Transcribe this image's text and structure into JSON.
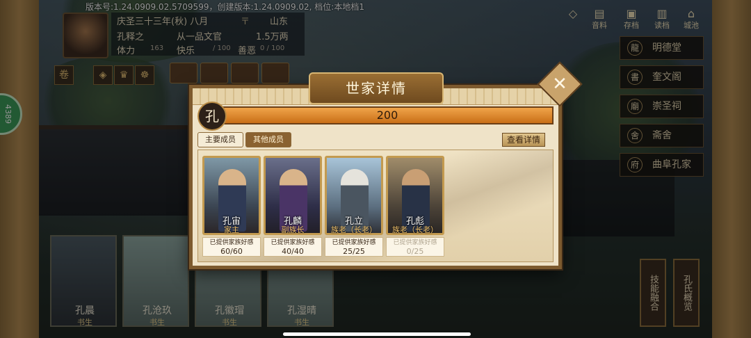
{
  "status": {
    "version_text": "版本号:1.24.0909.02.5709599，创建版本:1.24.0909.02, 档位:本地档1"
  },
  "player": {
    "date": "庆圣三十三年(秋) 八月",
    "location": "山东",
    "name": "孔释之",
    "rank": "从一品文官",
    "money": "1.5万两",
    "stamina_label": "体力",
    "stamina_value": "163",
    "happiness_label": "快乐",
    "happiness_value": "/ 100",
    "morality_label": "善恶",
    "morality_value": "0 / 100",
    "sidebar_coin": "4389"
  },
  "top_right_icons": [
    {
      "label": "音料",
      "icon": "book-icon"
    },
    {
      "label": "存档",
      "icon": "save-icon"
    },
    {
      "label": "读档",
      "icon": "load-icon"
    },
    {
      "label": "城池",
      "icon": "city-icon"
    }
  ],
  "side_menu": [
    {
      "label": "明德堂",
      "icon": "dragon-icon"
    },
    {
      "label": "奎文阁",
      "icon": "book-icon"
    },
    {
      "label": "崇圣祠",
      "icon": "temple-icon"
    },
    {
      "label": "斋舍",
      "icon": "house-icon"
    },
    {
      "label": "曲阜孔家",
      "icon": "mansion-icon"
    }
  ],
  "vertical_buttons": [
    {
      "label": "技能融合"
    },
    {
      "label": "孔氏概览"
    }
  ],
  "background_cards": [
    {
      "name": "孔晨",
      "rank": "书生"
    },
    {
      "name": "孔沧玖",
      "rank": "书生"
    },
    {
      "name": "孔徽瑁",
      "rank": "书生"
    },
    {
      "name": "孔湿晴",
      "rank": "书生"
    }
  ],
  "modal": {
    "title": "世家详情",
    "surname": "孔",
    "score": "200",
    "tabs": [
      "主要成员",
      "其他成员"
    ],
    "active_tab": "其他成员",
    "detail_button": "查看详情",
    "members": [
      {
        "name": "孔宙",
        "rank": "家主",
        "fav_label": "已提供家族好感",
        "fav_value": "60/60"
      },
      {
        "name": "孔麟",
        "rank": "副族长",
        "fav_label": "已提供家族好感",
        "fav_value": "40/40"
      },
      {
        "name": "孔立",
        "rank": "族老（长老）",
        "fav_label": "已提供家族好感",
        "fav_value": "25/25"
      },
      {
        "name": "孔彪",
        "rank": "族老（长老）",
        "fav_label": "已提供家族好感",
        "fav_value": "0/25"
      }
    ]
  }
}
